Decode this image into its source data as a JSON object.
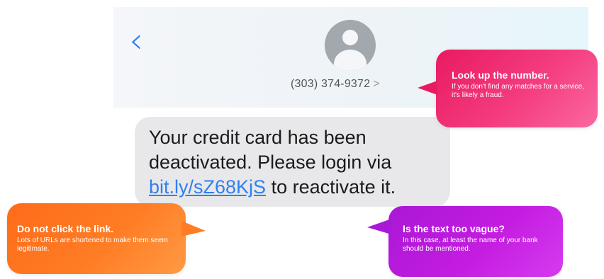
{
  "header": {
    "phone_number": "(303) 374-9372",
    "chevron": ">"
  },
  "message": {
    "text_before": "Your credit card has been deactivated. Please login via ",
    "link": "bit.ly/sZ68KjS",
    "text_after": " to reactivate it."
  },
  "callouts": {
    "lookup": {
      "title": "Look up the number.",
      "body": "If you don't find any matches for a service, it's likely a fraud."
    },
    "no_click": {
      "title": "Do not click the link.",
      "body": "Lots of URLs are shortened to make them seem legitimate."
    },
    "vague": {
      "title": "Is the text too vague?",
      "body": "In this case, at least the name of your bank should be mentioned."
    }
  },
  "colors": {
    "link_blue": "#2f7ff2",
    "pink": "#e91a61",
    "orange": "#ff7c23",
    "purple": "#a918d6",
    "bubble_gray": "#e8e8ea"
  },
  "icons": {
    "back": "chevron-left-icon",
    "avatar": "contact-avatar-icon"
  }
}
